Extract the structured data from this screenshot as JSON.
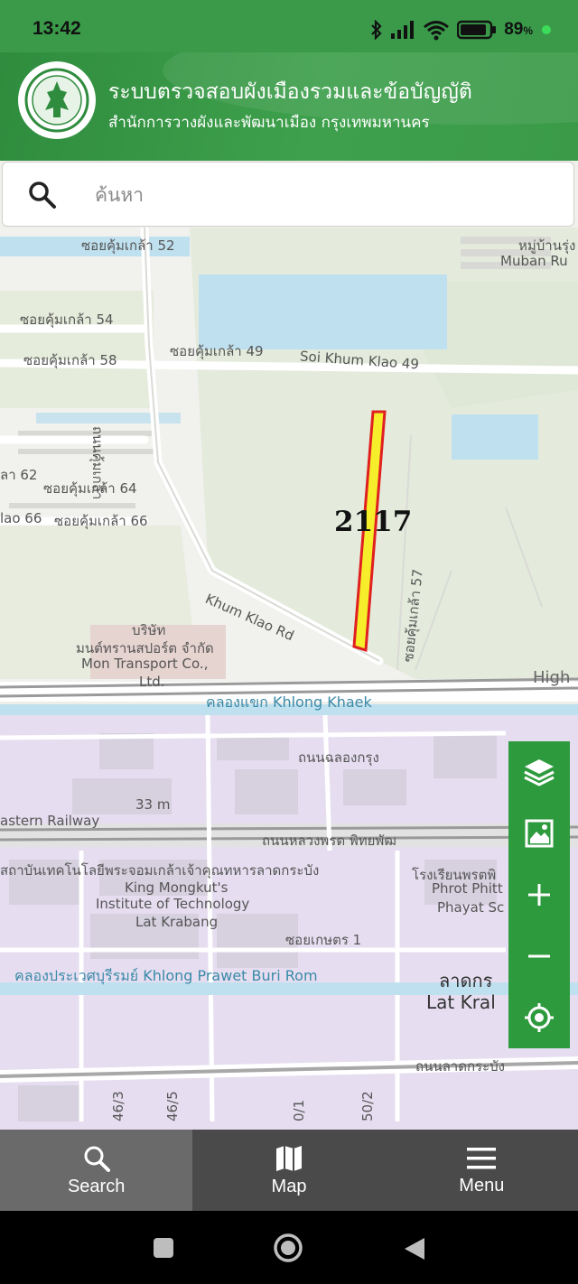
{
  "status_bar": {
    "time": "13:42",
    "battery": "89",
    "battery_unit": "%"
  },
  "header": {
    "title": "ระบบตรวจสอบผังเมืองรวมและข้อบัญญัติ",
    "subtitle": "สำนักการวางผังและพัฒนาเมือง กรุงเทพมหานคร"
  },
  "search": {
    "placeholder": "ค้นหา"
  },
  "map": {
    "parcel_label": "2117",
    "labels": {
      "soi52": "ซอยคุ้มเกล้า 52",
      "muban_th": "หมู่บ้านรุ่ง",
      "muban_en": "Muban Ru",
      "soi54": "ซอยคุ้มเกล้า 54",
      "soi58": "ซอยคุ้มเกล้า 58",
      "soi49": "ซอยคุ้มเกล้า 49",
      "soi49_en": "Soi Khum Klao 49",
      "khumklao_vert": "ถนนคุ้มเกล้า",
      "soi62": "ลา 62",
      "soi64": "ซอยคุ้มเกล้า 64",
      "soi66a": "lao 66",
      "soi66b": "ซอยคุ้มเกล้า 66",
      "soi57": "ซอยคุ้มเกล้า 57",
      "khumklao_rd": "Khum Klao Rd",
      "company1": "บริษัท",
      "company2": "มนต์ทรานสปอร์ต จำกัด",
      "company3": "Mon Transport Co.,",
      "company4": "Ltd.",
      "high": "High",
      "khlong_khaek": "คลองแขก Khlong Khaek",
      "chalong_krung": "ถนนฉลองกรุง",
      "elev": "33 m",
      "railway": "astern Railway",
      "luang_phrat": "ถนนหลวงพรต พิทยพัฒ",
      "kmitl_th": "สถาบันเทคโนโลยีพระจอมเกล้าเจ้าคุณทหารลาดกระบัง",
      "kmitl_en1": "King Mongkut's",
      "kmitl_en2": "Institute of Technology",
      "kmitl_en3": "Lat Krabang",
      "school_th": "โรงเรียนพรตพิ",
      "school_en1": "Phrot Phitt",
      "school_en2": "Phayat Sc",
      "soi_kaset": "ซอยเกษตร 1",
      "khlong_prawet": "คลองประเวศบุรีรมย์ Khlong Prawet Buri Rom",
      "lat_krabang_th": "ลาดกร",
      "lat_krabang_en": "Lat Kral",
      "lat_krabang_rd": "ถนนลาดกระบัง",
      "s46_3": "46/3",
      "s46_5": "46/5",
      "s0_1": "0/1",
      "s50_2": "50/2"
    }
  },
  "tools": [
    "layers-icon",
    "basemap-icon",
    "zoom-in-icon",
    "zoom-out-icon",
    "locate-icon"
  ],
  "bottom_nav": [
    {
      "label": "Search",
      "icon": "search-icon",
      "active": true
    },
    {
      "label": "Map",
      "icon": "map-icon",
      "active": false
    },
    {
      "label": "Menu",
      "icon": "menu-icon",
      "active": false
    }
  ]
}
